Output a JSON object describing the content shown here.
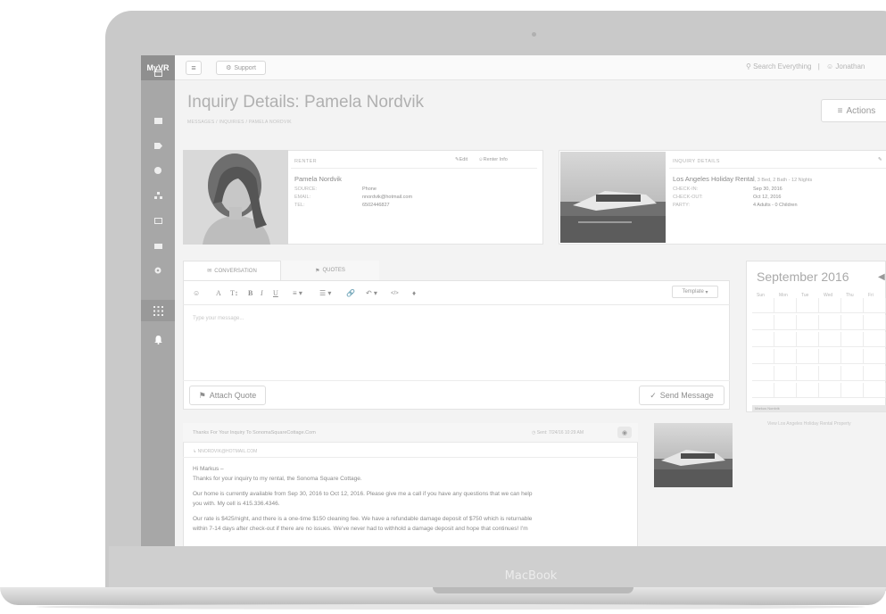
{
  "device": {
    "brand": "MacBook"
  },
  "app": {
    "logo": "MyVR"
  },
  "topbar": {
    "menu_icon": "hamburger-icon",
    "support_label": "Support",
    "search_label": "Search Everything",
    "user_name": "Jonathan"
  },
  "sidebar": {
    "icons": [
      "calendar-icon",
      "envelope-icon",
      "tag-icon",
      "pie-chart-icon",
      "sitemap-icon",
      "image-icon",
      "briefcase-icon",
      "gear-icon",
      "apps-grid-icon",
      "bell-icon"
    ]
  },
  "page": {
    "title": "Inquiry Details: Pamela Nordvik",
    "breadcrumbs": [
      "MESSAGES",
      "INQUIRIES",
      "PAMELA NORDVIK"
    ],
    "actions_label": "Actions"
  },
  "renter": {
    "section_label": "RENTER",
    "edit_label": "Edit",
    "info_label": "Renter Info",
    "name": "Pamela Nordvik",
    "source_key": "SOURCE:",
    "source_val": "Phone",
    "email_key": "EMAIL:",
    "email_val": "nnordvik@hotmail.com",
    "tel_key": "TEL:",
    "tel_val": "6502446827"
  },
  "inquiry": {
    "section_label": "INQUIRY DETAILS",
    "property": "Los Angeles Holiday Rental",
    "property_meta": ", 3 Bed, 2 Bath - 12 Nights",
    "checkin_key": "CHECK-IN:",
    "checkin_val": "Sep 30, 2016",
    "checkout_key": "CHECK-OUT:",
    "checkout_val": "Oct 12, 2016",
    "party_key": "PARTY:",
    "party_val": "4 Adults - 0 Children"
  },
  "tabs": {
    "conversation": "CONVERSATION",
    "quotes": "QUOTES"
  },
  "composer": {
    "template_label": "Template",
    "placeholder": "Type your message...",
    "attach_label": "Attach Quote",
    "send_label": "Send Message"
  },
  "message": {
    "subject": "Thanks For Your Inquiry To SonomaSquareCottage.Com",
    "date": "Sent: 7/24/16 10:29 AM",
    "to": "NNORDVIK@HOTMAIL.COM",
    "lines": [
      "Hi Markus –",
      "Thanks for your inquiry to my rental, the Sonoma Square Cottage.",
      "Our home is currently available from Sep 30, 2016 to Oct 12, 2016.  Please give me a call if you have any questions that we can help",
      "you with.  My cell is 415.336.4346.",
      "Our rate is $425/night, and there is a one-time $150 cleaning fee.  We have a refundable damage deposit of $750 which is returnable",
      "within 7-14 days after check-out if there are no issues. We've never had to withhold a damage deposit and hope that continues!  I'm"
    ]
  },
  "calendar": {
    "title": "September 2016",
    "days": [
      "Sun",
      "Mon",
      "Tue",
      "Wed",
      "Thu",
      "Fri"
    ],
    "booking_label": "Markus Nordvik",
    "link": "View Los Angeles Holiday Rental Property"
  }
}
